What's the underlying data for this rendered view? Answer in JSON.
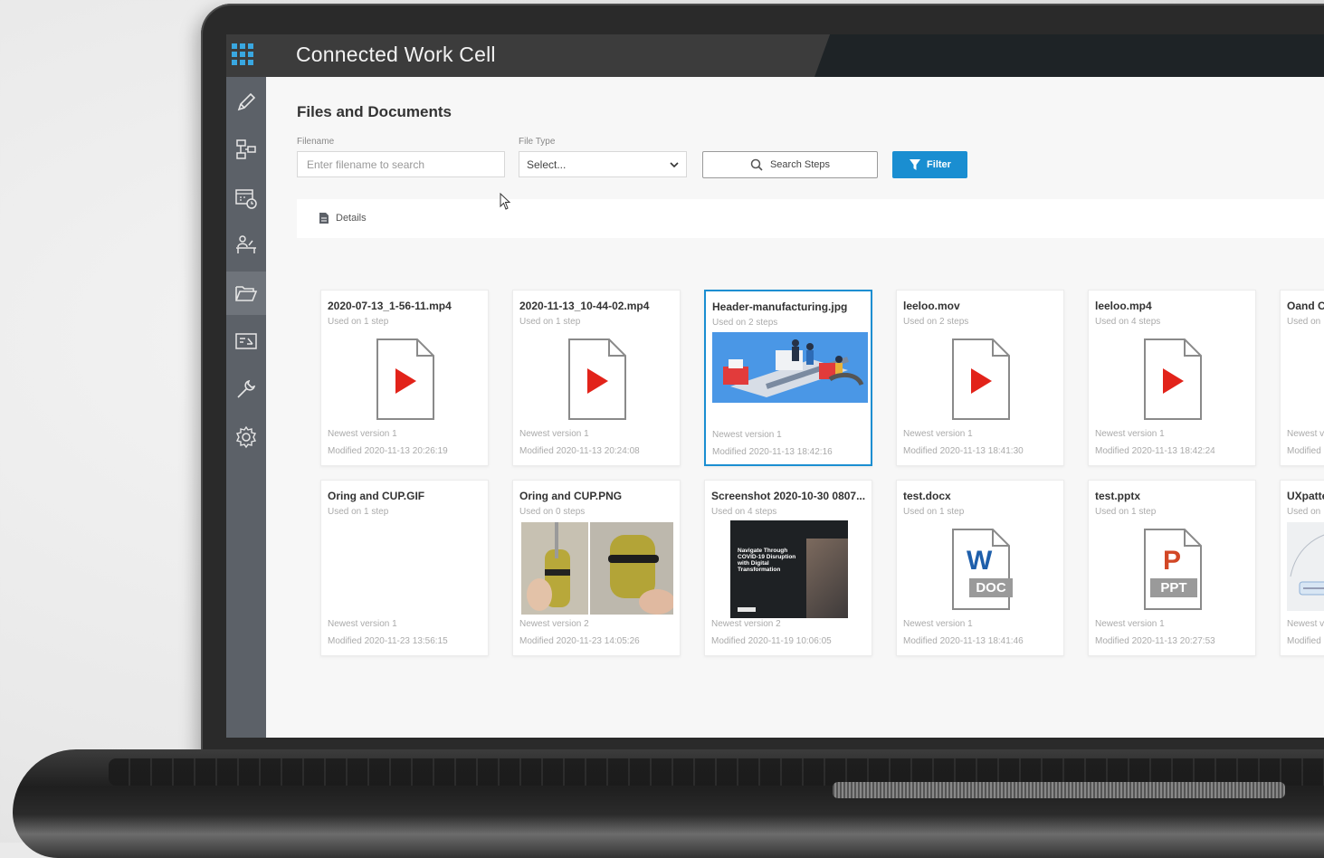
{
  "app": {
    "title": "Connected Work Cell"
  },
  "page": {
    "title": "Files and Documents"
  },
  "filters": {
    "filename_label": "Filename",
    "filename_placeholder": "Enter filename to search",
    "filetype_label": "File Type",
    "filetype_value": "Select...",
    "search_steps_label": "Search Steps",
    "filter_label": "Filter"
  },
  "details_tab": {
    "label": "Details"
  },
  "sidebar": {
    "items": [
      {
        "icon": "pencil-icon"
      },
      {
        "icon": "workflow-icon"
      },
      {
        "icon": "calendar-clock-icon"
      },
      {
        "icon": "operator-station-icon"
      },
      {
        "icon": "folder-icon",
        "active": true
      },
      {
        "icon": "board-icon"
      },
      {
        "icon": "wrench-icon"
      },
      {
        "icon": "gear-icon"
      }
    ]
  },
  "colors": {
    "accent": "#1a8ed1",
    "topbar": "#3c3c3c",
    "sidebar": "#5c6168",
    "play": "#e2231a",
    "word": "#1e5fab",
    "ppt": "#d24726"
  },
  "files": [
    {
      "name": "2020-07-13_1-56-11.mp4",
      "used": "Used on 1 step",
      "version": "Newest version 1",
      "modified": "Modified 2020-11-13 20:26:19",
      "kind": "video"
    },
    {
      "name": "2020-11-13_10-44-02.mp4",
      "used": "Used on 1 step",
      "version": "Newest version 1",
      "modified": "Modified 2020-11-13 20:24:08",
      "kind": "video"
    },
    {
      "name": "Header-manufacturing.jpg",
      "used": "Used on 2 steps",
      "version": "Newest version 1",
      "modified": "Modified 2020-11-13 18:42:16",
      "kind": "image-factory",
      "selected": true
    },
    {
      "name": "leeloo.mov",
      "used": "Used on 2 steps",
      "version": "Newest version 1",
      "modified": "Modified 2020-11-13 18:41:30",
      "kind": "video"
    },
    {
      "name": "leeloo.mp4",
      "used": "Used on 4 steps",
      "version": "Newest version 1",
      "modified": "Modified 2020-11-13 18:42:24",
      "kind": "video"
    },
    {
      "name": "Oand C",
      "used": "Used on",
      "version": "Newest v",
      "modified": "Modified",
      "kind": "blank"
    },
    {
      "name": "Oring and CUP.GIF",
      "used": "Used on 1 step",
      "version": "Newest version 1",
      "modified": "Modified 2020-11-23 13:56:15",
      "kind": "blank"
    },
    {
      "name": "Oring and CUP.PNG",
      "used": "Used on 0 steps",
      "version": "Newest version 2",
      "modified": "Modified 2020-11-23 14:05:26",
      "kind": "image-oring"
    },
    {
      "name": "Screenshot 2020-10-30 0807...",
      "used": "Used on 4 steps",
      "version": "Newest version 2",
      "modified": "Modified 2020-11-19 10:06:05",
      "kind": "image-screenshot",
      "thumb_text": "Navigate Through COVID-19 Disruption with Digital Transformation"
    },
    {
      "name": "test.docx",
      "used": "Used on 1 step",
      "version": "Newest version 1",
      "modified": "Modified 2020-11-13 18:41:46",
      "kind": "doc",
      "letter": "W",
      "badge": "DOC"
    },
    {
      "name": "test.pptx",
      "used": "Used on 1 step",
      "version": "Newest version 1",
      "modified": "Modified 2020-11-13 20:27:53",
      "kind": "ppt",
      "letter": "P",
      "badge": "PPT"
    },
    {
      "name": "UXpatte",
      "used": "Used on",
      "version": "Newest v",
      "modified": "Modified",
      "kind": "image-diagram"
    }
  ]
}
